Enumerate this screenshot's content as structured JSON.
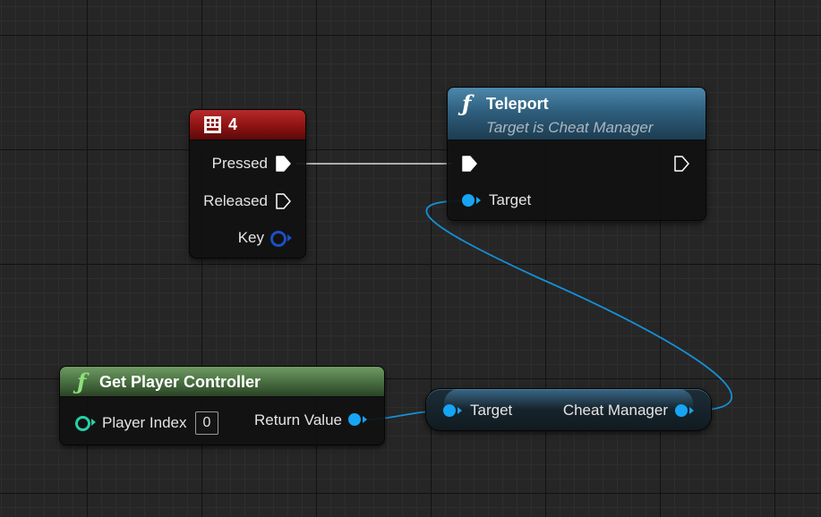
{
  "colors": {
    "exec_wire": "#e6e6e6",
    "object_pin": "#16a4f4",
    "key_pin": "#1b4fc4",
    "int_pin": "#25d2a5",
    "event_header": "#9a1616",
    "function_header": "#2f5f7e",
    "pure_function_header": "#4a7042"
  },
  "key_event_node": {
    "icon": "keyboard-key-icon",
    "title": "4",
    "pins": {
      "pressed": "Pressed",
      "released": "Released",
      "key": "Key"
    }
  },
  "teleport_node": {
    "icon": "function-icon",
    "title": "Teleport",
    "subtitle": "Target is Cheat Manager",
    "pins": {
      "target": "Target"
    }
  },
  "get_player_controller_node": {
    "icon": "function-icon",
    "title": "Get Player Controller",
    "pins": {
      "player_index": "Player Index",
      "player_index_value": "0",
      "return_value": "Return Value"
    }
  },
  "cast_node": {
    "pins": {
      "target": "Target",
      "cheat_manager": "Cheat Manager"
    }
  }
}
